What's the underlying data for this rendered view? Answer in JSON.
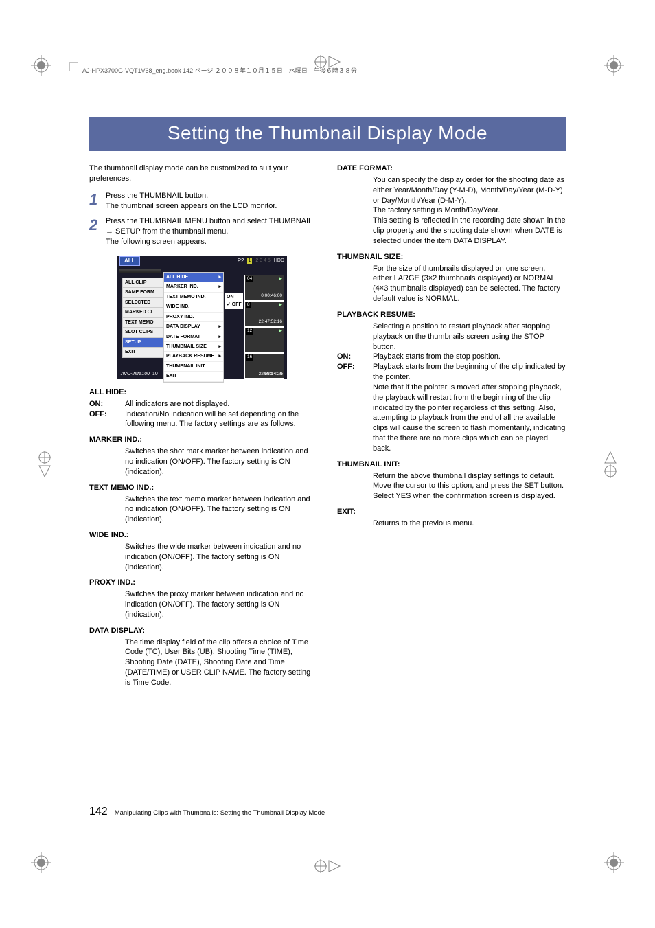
{
  "meta_header": "AJ-HPX3700G-VQT1V68_eng.book  142 ページ  ２００８年１０月１５日　水曜日　午後６時３８分",
  "title": "Setting the Thumbnail Display Mode",
  "intro": "The thumbnail display mode can be customized to suit your preferences.",
  "steps": {
    "s1": {
      "num": "1",
      "line1": "Press the THUMBNAIL button.",
      "line2": "The thumbnail screen appears on the LCD monitor."
    },
    "s2": {
      "num": "2",
      "line1": "Press the THUMBNAIL MENU button and select THUMBNAIL → SETUP from the thumbnail menu.",
      "line2": "The following screen appears."
    }
  },
  "screenshot": {
    "all": "ALL",
    "p2": "P2",
    "slot1": "1",
    "slots_rest": "2 3 4 5",
    "hdd": "HDD",
    "menu1": [
      "ALL CLIP",
      "SAME FORM",
      "SELECTED",
      "MARKED CL",
      "TEXT MEMO",
      "SLOT CLIPS",
      "SETUP",
      "EXIT"
    ],
    "menu2_top": "ALL HIDE",
    "menu2": [
      "MARKER IND.",
      "TEXT MEMO IND.",
      "WIDE IND.",
      "PROXY IND.",
      "DATA DISPLAY",
      "DATE FORMAT",
      "THUMBNAIL SIZE",
      "PLAYBACK RESUME",
      "THUMBNAIL INIT",
      "EXIT"
    ],
    "on": "ON",
    "off": "✓ OFF",
    "th_n": [
      "04",
      "8",
      "12",
      "16"
    ],
    "th_tc": [
      "0:00:46:00",
      "22:47:52:16",
      "22:58:14:20"
    ],
    "th_p": "▶",
    "bottom_left": "AVC-Intra100",
    "bottom_num": "10",
    "bottom_right": "00:04:16"
  },
  "defs": {
    "allhide": {
      "term": "ALL HIDE:",
      "on_label": "ON:",
      "on_text": "All indicators are not displayed.",
      "off_label": "OFF:",
      "off_text": "Indication/No indication will be set depending on the following menu. The factory settings are as follows."
    },
    "marker": {
      "term": "MARKER IND.:",
      "body": "Switches the shot mark marker between indication and no indication (ON/OFF). The factory setting is ON (indication)."
    },
    "textmemo": {
      "term": "TEXT MEMO IND.:",
      "body": "Switches the text memo marker between indication and no indication (ON/OFF). The factory setting is ON (indication)."
    },
    "wide": {
      "term": "WIDE IND.:",
      "body": "Switches the wide marker between indication and no indication (ON/OFF). The factory setting is ON (indication)."
    },
    "proxy": {
      "term": "PROXY IND.:",
      "body": "Switches the proxy marker between indication and no indication (ON/OFF). The factory setting is ON (indication)."
    },
    "datadisplay": {
      "term": "DATA DISPLAY:",
      "body": "The time display field of the clip offers a choice of Time Code (TC), User Bits (UB), Shooting Time (TIME), Shooting Date (DATE), Shooting Date and Time (DATE/TIME) or USER CLIP NAME. The factory setting is Time Code."
    },
    "dateformat": {
      "term": "DATE FORMAT:",
      "body1": "You can specify the display order for the shooting date as either Year/Month/Day (Y-M-D), Month/Day/Year (M-D-Y) or Day/Month/Year (D-M-Y).",
      "body2": "The factory setting is Month/Day/Year.",
      "body3": "This setting is reflected in the recording date shown in the clip property and the shooting date shown when DATE is selected under the item DATA DISPLAY."
    },
    "thumbsize": {
      "term": "THUMBNAIL SIZE:",
      "body": "For the size of thumbnails displayed on one screen, either LARGE (3×2 thumbnails displayed) or NORMAL (4×3 thumbnails displayed) can be selected. The factory default value is NORMAL."
    },
    "playback": {
      "term": "PLAYBACK RESUME:",
      "body": "Selecting a position to restart playback after stopping playback on the thumbnails screen using the STOP button.",
      "on_label": "ON:",
      "on_text": "Playback starts from the stop position.",
      "off_label": "OFF:",
      "off_text": "Playback starts from the beginning of the clip indicated by the pointer.",
      "note": "Note that if the pointer is moved after stopping playback, the playback will restart from the beginning of the clip indicated by the pointer regardless of this setting. Also, attempting to playback from the end of all the available clips will cause the screen to flash momentarily, indicating that the there are no more clips which can be played back."
    },
    "thumbinit": {
      "term": "THUMBNAIL INIT:",
      "body": "Return the above thumbnail display settings to default. Move the cursor to this option, and press the SET button. Select YES when the confirmation screen is displayed."
    },
    "exit": {
      "term": "EXIT:",
      "body": "Returns to the previous menu."
    }
  },
  "footer": {
    "page": "142",
    "text": "Manipulating Clips with Thumbnails: Setting the Thumbnail Display Mode"
  }
}
